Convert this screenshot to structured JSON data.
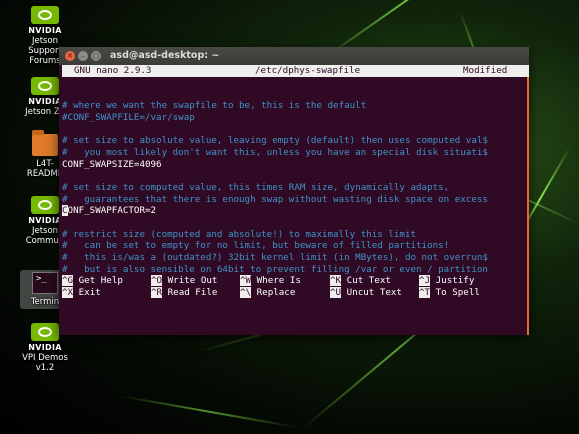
{
  "desktop": {
    "icons": [
      {
        "lines": [
          "NVIDIA",
          "Jetson",
          "Support",
          "Forums"
        ],
        "type": "nvidia"
      },
      {
        "lines": [
          "NVIDIA",
          "Jetson Zo"
        ],
        "type": "nvidia"
      },
      {
        "lines": [
          "L4T-",
          "README"
        ],
        "type": "folder"
      },
      {
        "lines": [
          "NVIDIA",
          "Jetson",
          "Commun"
        ],
        "type": "nvidia"
      },
      {
        "lines": [
          "Termin"
        ],
        "type": "terminal"
      },
      {
        "lines": [
          "NVIDIA",
          "VPI Demos",
          "v1.2"
        ],
        "type": "nvidia"
      }
    ]
  },
  "window": {
    "title": "asd@asd-desktop: ~",
    "nano_header": {
      "version": "GNU nano 2.9.3",
      "file": "/etc/dphys-swapfile",
      "status": "Modified"
    },
    "content_lines": [
      {
        "text": "",
        "type": "blank"
      },
      {
        "text": "",
        "type": "blank"
      },
      {
        "text": "# where we want the swapfile to be, this is the default",
        "type": "comment"
      },
      {
        "text": "#CONF_SWAPFILE=/var/swap",
        "type": "comment"
      },
      {
        "text": "",
        "type": "blank"
      },
      {
        "text": "# set size to absolute value, leaving empty (default) then uses computed val$",
        "type": "comment"
      },
      {
        "text": "#   you most likely don't want this, unless you have an special disk situati$",
        "type": "comment"
      },
      {
        "text": "CONF_SWAPSIZE=4096",
        "type": "code"
      },
      {
        "text": "",
        "type": "blank"
      },
      {
        "text": "# set size to computed value, this times RAM size, dynamically adapts,",
        "type": "comment"
      },
      {
        "text": "#   guarantees that there is enough swap without wasting disk space on excess",
        "type": "comment"
      },
      {
        "text": "CONF_SWAPFACTOR=2",
        "type": "cursor"
      },
      {
        "text": "",
        "type": "blank"
      },
      {
        "text": "# restrict size (computed and absolute!) to maximally this limit",
        "type": "comment"
      },
      {
        "text": "#   can be set to empty for no limit, but beware of filled partitions!",
        "type": "comment"
      },
      {
        "text": "#   this is/was a (outdated?) 32bit kernel limit (in MBytes), do not overrun$",
        "type": "comment"
      },
      {
        "text": "#   but is also sensible on 64bit to prevent filling /var or even / partition",
        "type": "comment"
      }
    ],
    "shortcuts": [
      [
        {
          "key": "^G",
          "label": "Get Help"
        },
        {
          "key": "^O",
          "label": "Write Out"
        },
        {
          "key": "^W",
          "label": "Where Is"
        },
        {
          "key": "^K",
          "label": "Cut Text"
        },
        {
          "key": "^J",
          "label": "Justify"
        }
      ],
      [
        {
          "key": "^X",
          "label": "Exit"
        },
        {
          "key": "^R",
          "label": "Read File"
        },
        {
          "key": "^\\",
          "label": "Replace"
        },
        {
          "key": "^U",
          "label": "Uncut Text"
        },
        {
          "key": "^T",
          "label": "To Spell"
        }
      ]
    ]
  }
}
